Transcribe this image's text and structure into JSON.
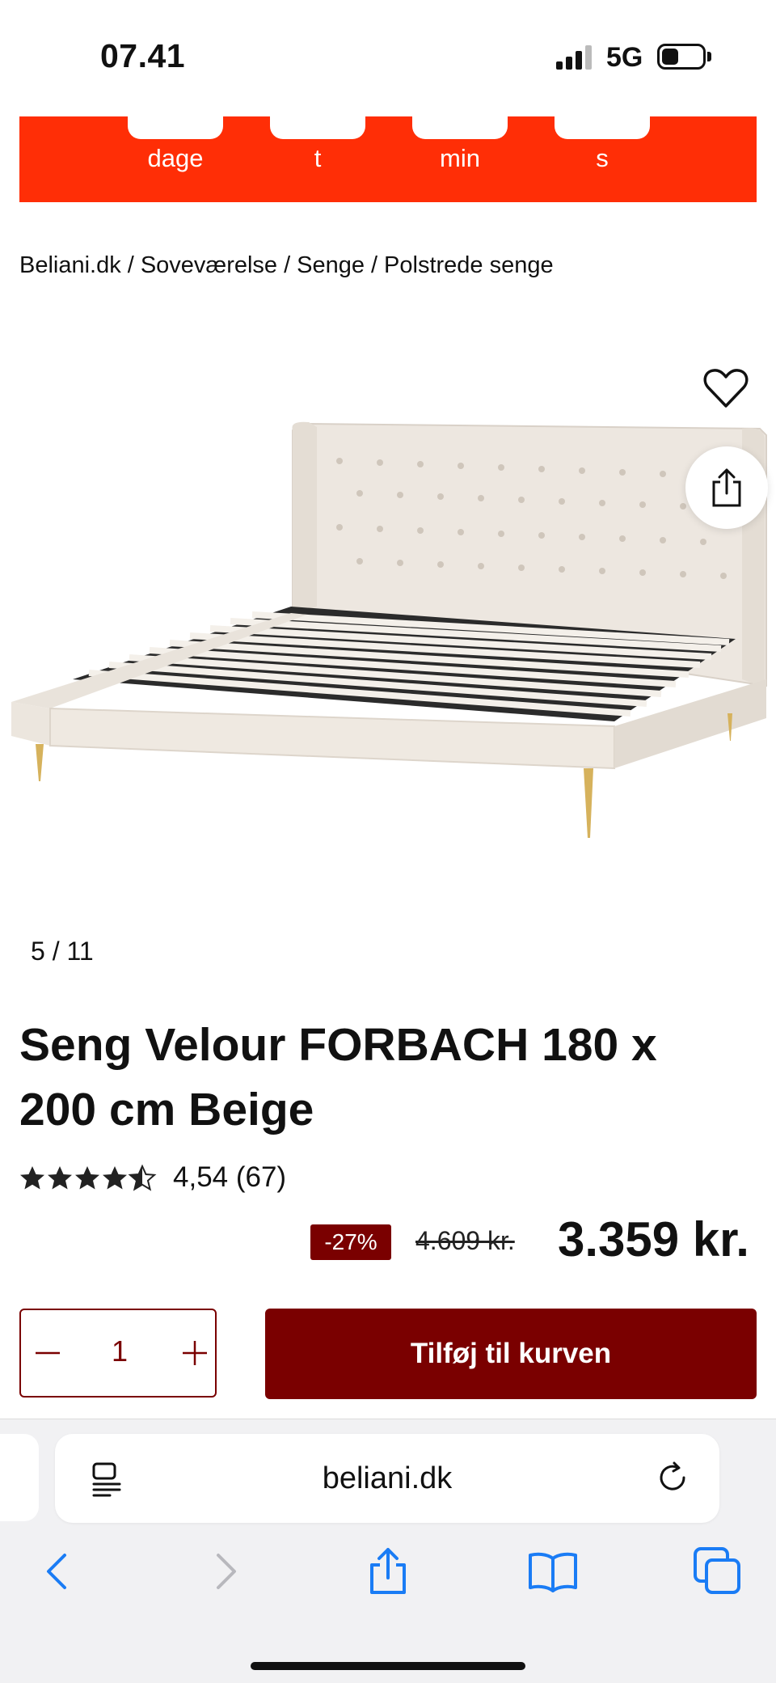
{
  "status_bar": {
    "time": "07.41",
    "network": "5G"
  },
  "countdown": {
    "accent_color": "#ff2e06",
    "units": [
      "dage",
      "t",
      "min",
      "s"
    ]
  },
  "breadcrumb": [
    "Beliani.dk",
    "Soveværelse",
    "Senge",
    "Polstrede senge"
  ],
  "gallery": {
    "counter": "5 / 11",
    "image_alt": "bed-photo"
  },
  "product": {
    "title": "Seng Velour FORBACH 180 x 200 cm Beige",
    "rating_value": 4.54,
    "rating_text": "4,54 (67)",
    "discount": "-27%",
    "old_price": "4.609 kr.",
    "price": "3.359 kr.",
    "quantity": "1",
    "add_to_cart_label": "Tilføj til kurven",
    "brand_color": "#7a0000"
  },
  "browser": {
    "url": "beliani.dk",
    "toolbar": [
      "back-icon",
      "forward-icon",
      "share-icon",
      "bookmarks-icon",
      "tabs-icon"
    ]
  }
}
